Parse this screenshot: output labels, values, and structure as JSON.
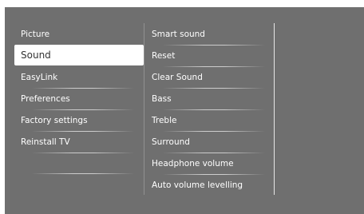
{
  "menu": {
    "items": [
      {
        "label": "Picture"
      },
      {
        "label": "Sound"
      },
      {
        "label": "EasyLink"
      },
      {
        "label": "Preferences"
      },
      {
        "label": "Factory settings"
      },
      {
        "label": "Reinstall TV"
      }
    ],
    "selected": "Sound"
  },
  "submenu": {
    "items": [
      {
        "label": "Smart sound"
      },
      {
        "label": "Reset"
      },
      {
        "label": "Clear Sound"
      },
      {
        "label": "Bass"
      },
      {
        "label": "Treble"
      },
      {
        "label": "Surround"
      },
      {
        "label": "Headphone volume"
      },
      {
        "label": "Auto volume levelling"
      }
    ]
  },
  "colors": {
    "background": "#6f6f6f",
    "highlight": "#ffffff",
    "text": "#ffffff"
  }
}
